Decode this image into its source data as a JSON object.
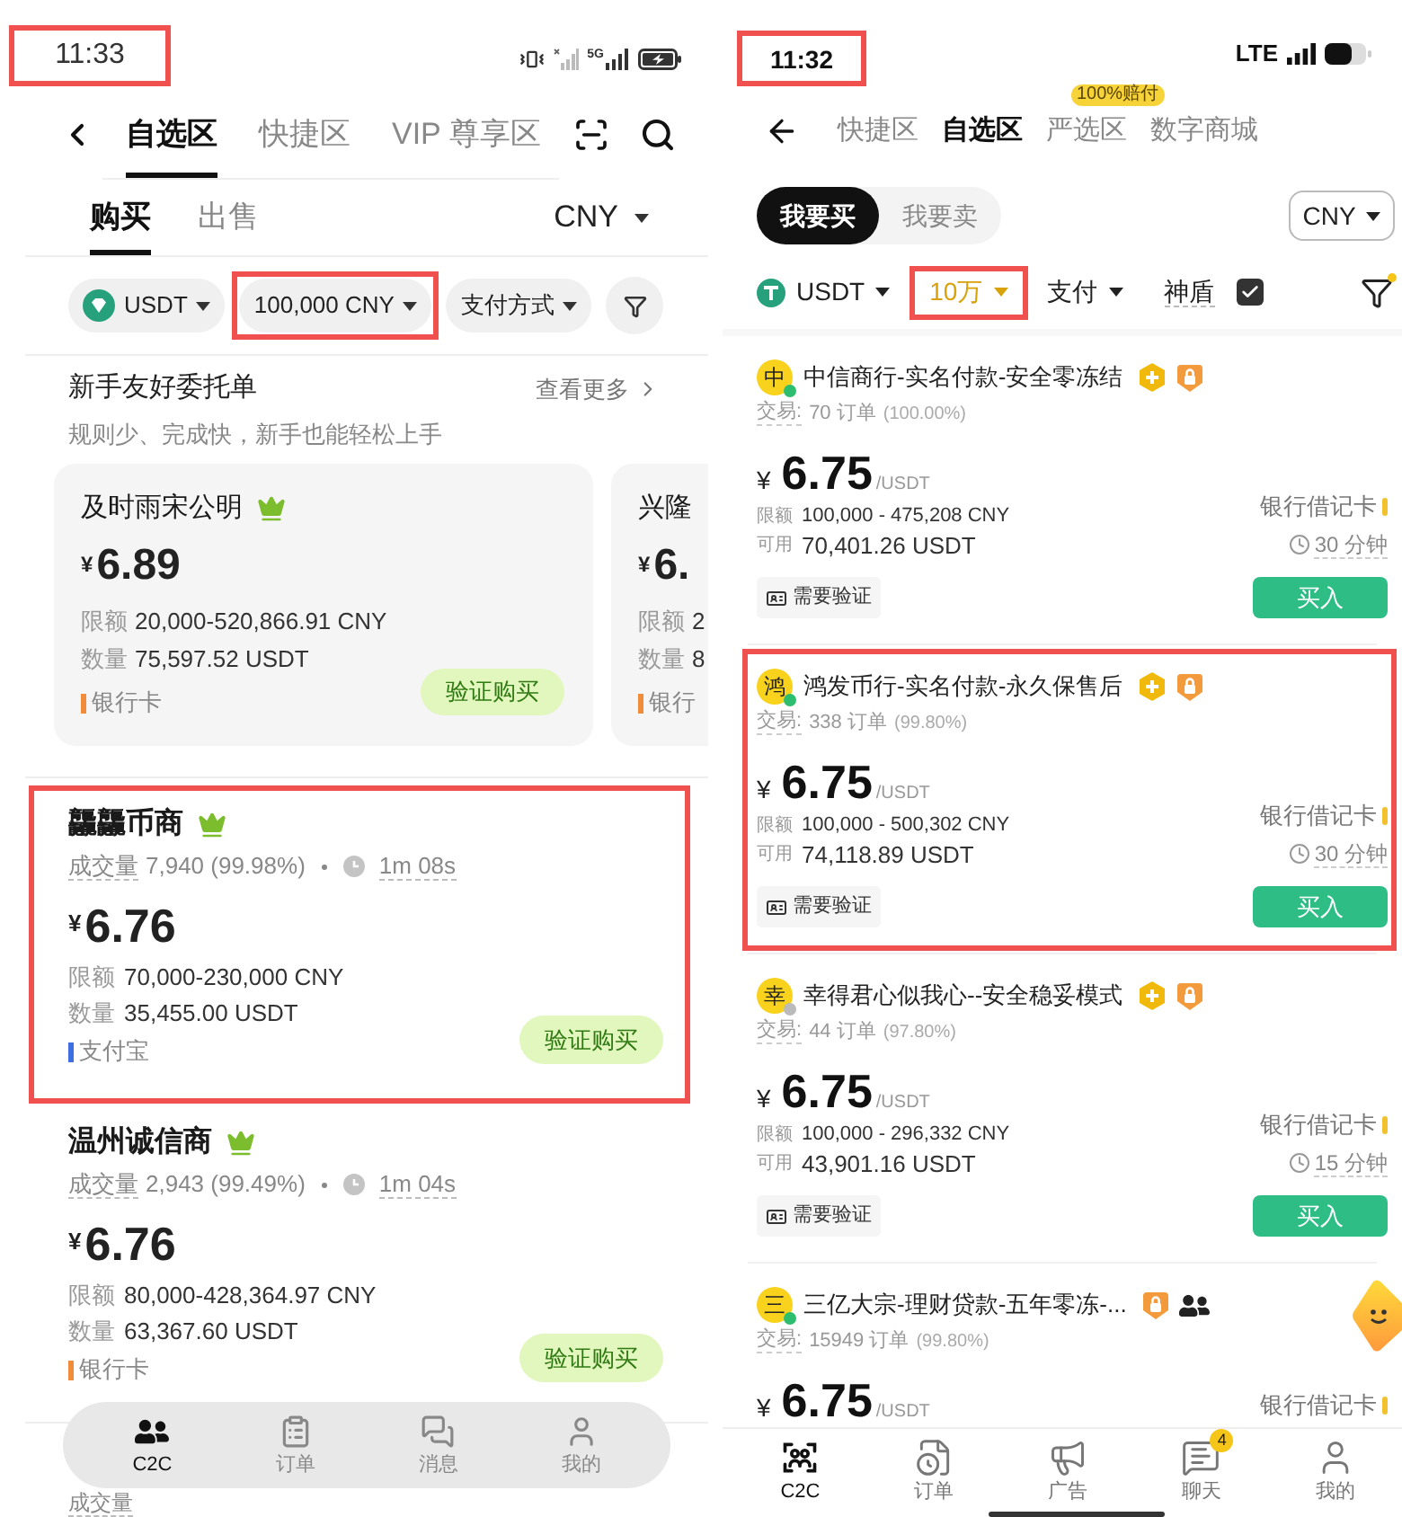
{
  "left_screen": {
    "status_bar": {
      "time": "11:33",
      "highlighted": true,
      "network": "5G"
    },
    "nav_tabs": [
      {
        "label": "自选区",
        "selected": true
      },
      {
        "label": "快捷区",
        "selected": false
      },
      {
        "label": "VIP 尊享区",
        "selected": false
      }
    ],
    "trade_tabs": [
      {
        "label": "购买",
        "selected": true
      },
      {
        "label": "出售",
        "selected": false
      }
    ],
    "currency_select": "CNY",
    "filters": [
      {
        "kind": "coin",
        "label": "USDT",
        "highlighted": false
      },
      {
        "kind": "amount",
        "label": "100,000 CNY",
        "highlighted": true
      },
      {
        "kind": "payment",
        "label": "支付方式",
        "highlighted": false
      }
    ],
    "featured": {
      "title": "新手友好委托单",
      "more": "查看更多",
      "subtitle": "规则少、完成快，新手也能轻松上手",
      "cards": [
        {
          "name": "及时雨宋公明",
          "crown": true,
          "currency": "¥",
          "price": "6.89",
          "lines": [
            {
              "label": "限额",
              "value": "20,000-520,866.91 CNY"
            },
            {
              "label": "数量",
              "value": "75,597.52 USDT"
            }
          ],
          "payment": {
            "label": "银行卡",
            "color": "#f08c3a"
          },
          "button": "验证购买"
        },
        {
          "name": "兴隆",
          "crown": false,
          "currency": "¥",
          "price": "6.",
          "lines": [
            {
              "label": "限额",
              "value": "2"
            },
            {
              "label": "数量",
              "value": "8"
            }
          ],
          "payment": {
            "label": "银行",
            "color": "#f08c3a"
          }
        }
      ]
    },
    "listings": [
      {
        "name": "龘龘币商",
        "crown": true,
        "highlighted": true,
        "stats_label": "成交量",
        "stats": "7,940 (99.98%)",
        "time": "1m 08s",
        "currency": "¥",
        "price": "6.76",
        "lines": [
          {
            "label": "限额",
            "value": "70,000-230,000 CNY"
          },
          {
            "label": "数量",
            "value": "35,455.00 USDT"
          }
        ],
        "payment": {
          "label": "支付宝",
          "color": "#3d6fe0"
        },
        "button": "验证购买"
      },
      {
        "name": "温州诚信商",
        "crown": true,
        "highlighted": false,
        "stats_label": "成交量",
        "stats": "2,943 (99.49%)",
        "time": "1m 04s",
        "currency": "¥",
        "price": "6.76",
        "lines": [
          {
            "label": "限额",
            "value": "80,000-428,364.97 CNY"
          },
          {
            "label": "数量",
            "value": "63,367.60 USDT"
          }
        ],
        "payment": {
          "label": "银行卡",
          "color": "#f08c3a"
        },
        "button": "验证购买"
      }
    ],
    "partial_row": {
      "stats_label": "成交量"
    },
    "bottom_nav": [
      {
        "kind": "c2c",
        "label": "C2C",
        "selected": true
      },
      {
        "kind": "orders",
        "label": "订单",
        "selected": false
      },
      {
        "kind": "messages",
        "label": "消息",
        "selected": false
      },
      {
        "kind": "profile",
        "label": "我的",
        "selected": false
      }
    ]
  },
  "right_screen": {
    "status_bar": {
      "time": "11:32",
      "highlighted": true,
      "network": "LTE"
    },
    "nav_tabs": [
      {
        "label": "快捷区",
        "selected": false
      },
      {
        "label": "自选区",
        "selected": true
      },
      {
        "label": "严选区",
        "selected": false,
        "badge": "100%赔付"
      },
      {
        "label": "数字商城",
        "selected": false
      }
    ],
    "side_toggle": [
      {
        "label": "我要买",
        "selected": true
      },
      {
        "label": "我要卖",
        "selected": false
      }
    ],
    "currency_select": "CNY",
    "filters": [
      {
        "kind": "coin",
        "label": "USDT",
        "highlighted": false,
        "active": false
      },
      {
        "kind": "amount",
        "label": "10万",
        "highlighted": true,
        "active": true
      },
      {
        "kind": "payment",
        "label": "支付",
        "highlighted": false,
        "active": false
      },
      {
        "kind": "toggle",
        "label": "神盾",
        "checked": true
      }
    ],
    "filter_badge": true,
    "listings": [
      {
        "initial": "中",
        "online": true,
        "name": "中信商行-实名付款-安全零冻结",
        "badges": [
          {
            "kind": "medal"
          },
          {
            "kind": "lock"
          }
        ],
        "highlighted": false,
        "trades_label": "交易:",
        "trades": "70 订单",
        "rate": "(100.00%)",
        "currency": "¥",
        "price": "6.75",
        "unit": "/USDT",
        "lines": [
          {
            "label": "限额",
            "value": "100,000 - 475,208 CNY"
          },
          {
            "label": "可用",
            "value": "70,401.26 USDT"
          }
        ],
        "payments": [
          {
            "label": "银行借记卡",
            "color": "#f2c12e"
          }
        ],
        "time_limit": "30 分钟",
        "tag": "需要验证",
        "button": "买入"
      },
      {
        "initial": "鸿",
        "online": true,
        "name": "鸿发币行-实名付款-永久保售后",
        "badges": [
          {
            "kind": "medal"
          },
          {
            "kind": "lock"
          }
        ],
        "highlighted": true,
        "trades_label": "交易:",
        "trades": "338 订单",
        "rate": "(99.80%)",
        "currency": "¥",
        "price": "6.75",
        "unit": "/USDT",
        "lines": [
          {
            "label": "限额",
            "value": "100,000 - 500,302 CNY"
          },
          {
            "label": "可用",
            "value": "74,118.89 USDT"
          }
        ],
        "payments": [
          {
            "label": "银行借记卡",
            "color": "#f2c12e"
          }
        ],
        "time_limit": "30 分钟",
        "tag": "需要验证",
        "button": "买入"
      },
      {
        "initial": "幸",
        "online": false,
        "name": "幸得君心似我心--安全稳妥模式",
        "badges": [
          {
            "kind": "medal"
          },
          {
            "kind": "lock"
          }
        ],
        "highlighted": false,
        "trades_label": "交易:",
        "trades": "44 订单",
        "rate": "(97.80%)",
        "currency": "¥",
        "price": "6.75",
        "unit": "/USDT",
        "lines": [
          {
            "label": "限额",
            "value": "100,000 - 296,332 CNY"
          },
          {
            "label": "可用",
            "value": "43,901.16 USDT"
          }
        ],
        "payments": [
          {
            "label": "银行借记卡",
            "color": "#f2c12e"
          }
        ],
        "time_limit": "15 分钟",
        "tag": "需要验证",
        "button": "买入"
      },
      {
        "initial": "三",
        "online": true,
        "name": "三亿大宗-理财贷款-五年零冻-...",
        "badges": [
          {
            "kind": "lock"
          },
          {
            "kind": "group"
          }
        ],
        "highlighted": false,
        "trades_label": "交易:",
        "trades": "15949 订单",
        "rate": "(99.80%)",
        "currency": "¥",
        "price": "6.75",
        "unit": "/USDT",
        "payments": [
          {
            "label": "银行借记卡",
            "color": "#f2c12e"
          }
        ]
      }
    ],
    "bottom_nav": [
      {
        "kind": "c2c",
        "label": "C2C",
        "selected": true
      },
      {
        "kind": "orders",
        "label": "订单",
        "selected": false
      },
      {
        "kind": "ads",
        "label": "广告",
        "selected": false
      },
      {
        "kind": "chat",
        "label": "聊天",
        "selected": false,
        "badge": "4"
      },
      {
        "kind": "profile",
        "label": "我的",
        "selected": false
      }
    ]
  }
}
